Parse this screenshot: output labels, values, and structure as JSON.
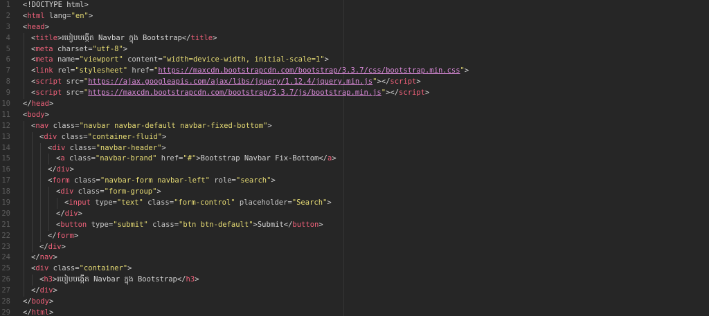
{
  "editor": {
    "lines": [
      {
        "n": "1",
        "indent": 0,
        "tokens": [
          {
            "t": "<!DOCTYPE html>",
            "c": "txt"
          }
        ]
      },
      {
        "n": "2",
        "indent": 0,
        "tokens": [
          {
            "t": "<",
            "c": "txt"
          },
          {
            "t": "html",
            "c": "tag"
          },
          {
            "t": " lang=",
            "c": "attr"
          },
          {
            "t": "\"en\"",
            "c": "str"
          },
          {
            "t": ">",
            "c": "txt"
          }
        ]
      },
      {
        "n": "3",
        "indent": 0,
        "tokens": [
          {
            "t": "<",
            "c": "txt"
          },
          {
            "t": "head",
            "c": "tag"
          },
          {
            "t": ">",
            "c": "txt"
          }
        ]
      },
      {
        "n": "4",
        "indent": 1,
        "tokens": [
          {
            "t": "<",
            "c": "txt"
          },
          {
            "t": "title",
            "c": "tag"
          },
          {
            "t": ">",
            "c": "txt"
          },
          {
            "t": "របៀបបង្កើត Navbar ក្នុង Bootstrap",
            "c": "txt"
          },
          {
            "t": "</",
            "c": "txt"
          },
          {
            "t": "title",
            "c": "tag"
          },
          {
            "t": ">",
            "c": "txt"
          }
        ]
      },
      {
        "n": "5",
        "indent": 1,
        "tokens": [
          {
            "t": "<",
            "c": "txt"
          },
          {
            "t": "meta",
            "c": "tag"
          },
          {
            "t": " charset=",
            "c": "attr"
          },
          {
            "t": "\"utf-8\"",
            "c": "str"
          },
          {
            "t": ">",
            "c": "txt"
          }
        ]
      },
      {
        "n": "6",
        "indent": 1,
        "tokens": [
          {
            "t": "<",
            "c": "txt"
          },
          {
            "t": "meta",
            "c": "tag"
          },
          {
            "t": " name=",
            "c": "attr"
          },
          {
            "t": "\"viewport\"",
            "c": "str"
          },
          {
            "t": " content=",
            "c": "attr"
          },
          {
            "t": "\"width=device-width, initial-scale=1\"",
            "c": "str"
          },
          {
            "t": ">",
            "c": "txt"
          }
        ]
      },
      {
        "n": "7",
        "indent": 1,
        "tokens": [
          {
            "t": "<",
            "c": "txt"
          },
          {
            "t": "link",
            "c": "tag"
          },
          {
            "t": " rel=",
            "c": "attr"
          },
          {
            "t": "\"stylesheet\"",
            "c": "str"
          },
          {
            "t": " href=",
            "c": "attr"
          },
          {
            "t": "\"",
            "c": "str"
          },
          {
            "t": "https://maxcdn.bootstrapcdn.com/bootstrap/3.3.7/css/bootstrap.min.css",
            "c": "url"
          },
          {
            "t": "\"",
            "c": "str"
          },
          {
            "t": ">",
            "c": "txt"
          }
        ]
      },
      {
        "n": "8",
        "indent": 1,
        "tokens": [
          {
            "t": "<",
            "c": "txt"
          },
          {
            "t": "script",
            "c": "tag"
          },
          {
            "t": " src=",
            "c": "attr"
          },
          {
            "t": "\"",
            "c": "str"
          },
          {
            "t": "https://ajax.googleapis.com/ajax/libs/jquery/1.12.4/jquery.min.js",
            "c": "url"
          },
          {
            "t": "\"",
            "c": "str"
          },
          {
            "t": "></",
            "c": "txt"
          },
          {
            "t": "script",
            "c": "tag"
          },
          {
            "t": ">",
            "c": "txt"
          }
        ]
      },
      {
        "n": "9",
        "indent": 1,
        "tokens": [
          {
            "t": "<",
            "c": "txt"
          },
          {
            "t": "script",
            "c": "tag"
          },
          {
            "t": " src=",
            "c": "attr"
          },
          {
            "t": "\"",
            "c": "str"
          },
          {
            "t": "https://maxcdn.bootstrapcdn.com/bootstrap/3.3.7/js/bootstrap.min.js",
            "c": "url"
          },
          {
            "t": "\"",
            "c": "str"
          },
          {
            "t": "></",
            "c": "txt"
          },
          {
            "t": "script",
            "c": "tag"
          },
          {
            "t": ">",
            "c": "txt"
          }
        ]
      },
      {
        "n": "10",
        "indent": 0,
        "tokens": [
          {
            "t": "</",
            "c": "txt"
          },
          {
            "t": "head",
            "c": "tag"
          },
          {
            "t": ">",
            "c": "txt"
          }
        ]
      },
      {
        "n": "11",
        "indent": 0,
        "tokens": [
          {
            "t": "<",
            "c": "txt"
          },
          {
            "t": "body",
            "c": "tag"
          },
          {
            "t": ">",
            "c": "txt"
          }
        ]
      },
      {
        "n": "12",
        "indent": 1,
        "tokens": [
          {
            "t": "<",
            "c": "txt"
          },
          {
            "t": "nav",
            "c": "tag"
          },
          {
            "t": " class=",
            "c": "attr"
          },
          {
            "t": "\"navbar navbar-default navbar-fixed-bottom\"",
            "c": "str"
          },
          {
            "t": ">",
            "c": "txt"
          }
        ]
      },
      {
        "n": "13",
        "indent": 2,
        "tokens": [
          {
            "t": "<",
            "c": "txt"
          },
          {
            "t": "div",
            "c": "tag"
          },
          {
            "t": " class=",
            "c": "attr"
          },
          {
            "t": "\"container-fluid\"",
            "c": "str"
          },
          {
            "t": ">",
            "c": "txt"
          }
        ]
      },
      {
        "n": "14",
        "indent": 3,
        "tokens": [
          {
            "t": "<",
            "c": "txt"
          },
          {
            "t": "div",
            "c": "tag"
          },
          {
            "t": " class=",
            "c": "attr"
          },
          {
            "t": "\"navbar-header\"",
            "c": "str"
          },
          {
            "t": ">",
            "c": "txt"
          }
        ]
      },
      {
        "n": "15",
        "indent": 4,
        "tokens": [
          {
            "t": "<",
            "c": "txt"
          },
          {
            "t": "a",
            "c": "tag"
          },
          {
            "t": " class=",
            "c": "attr"
          },
          {
            "t": "\"navbar-brand\"",
            "c": "str"
          },
          {
            "t": " href=",
            "c": "attr"
          },
          {
            "t": "\"#\"",
            "c": "str"
          },
          {
            "t": ">Bootstrap Navbar Fix-Bottom</",
            "c": "txt"
          },
          {
            "t": "a",
            "c": "tag"
          },
          {
            "t": ">",
            "c": "txt"
          }
        ]
      },
      {
        "n": "16",
        "indent": 3,
        "tokens": [
          {
            "t": "</",
            "c": "txt"
          },
          {
            "t": "div",
            "c": "tag"
          },
          {
            "t": ">",
            "c": "txt"
          }
        ]
      },
      {
        "n": "17",
        "indent": 3,
        "tokens": [
          {
            "t": "<",
            "c": "txt"
          },
          {
            "t": "form",
            "c": "tag"
          },
          {
            "t": " class=",
            "c": "attr"
          },
          {
            "t": "\"navbar-form navbar-left\"",
            "c": "str"
          },
          {
            "t": " role=",
            "c": "attr"
          },
          {
            "t": "\"search\"",
            "c": "str"
          },
          {
            "t": ">",
            "c": "txt"
          }
        ]
      },
      {
        "n": "18",
        "indent": 4,
        "tokens": [
          {
            "t": "<",
            "c": "txt"
          },
          {
            "t": "div",
            "c": "tag"
          },
          {
            "t": " class=",
            "c": "attr"
          },
          {
            "t": "\"form-group\"",
            "c": "str"
          },
          {
            "t": ">",
            "c": "txt"
          }
        ]
      },
      {
        "n": "19",
        "indent": 5,
        "tokens": [
          {
            "t": "<",
            "c": "txt"
          },
          {
            "t": "input",
            "c": "tag"
          },
          {
            "t": " type=",
            "c": "attr"
          },
          {
            "t": "\"text\"",
            "c": "str"
          },
          {
            "t": " class=",
            "c": "attr"
          },
          {
            "t": "\"form-control\"",
            "c": "str"
          },
          {
            "t": " placeholder=",
            "c": "attr"
          },
          {
            "t": "\"Search\"",
            "c": "str"
          },
          {
            "t": ">",
            "c": "txt"
          }
        ]
      },
      {
        "n": "20",
        "indent": 4,
        "tokens": [
          {
            "t": "</",
            "c": "txt"
          },
          {
            "t": "div",
            "c": "tag"
          },
          {
            "t": ">",
            "c": "txt"
          }
        ]
      },
      {
        "n": "21",
        "indent": 4,
        "tokens": [
          {
            "t": "<",
            "c": "txt"
          },
          {
            "t": "button",
            "c": "tag"
          },
          {
            "t": " type=",
            "c": "attr"
          },
          {
            "t": "\"submit\"",
            "c": "str"
          },
          {
            "t": " class=",
            "c": "attr"
          },
          {
            "t": "\"btn btn-default\"",
            "c": "str"
          },
          {
            "t": ">Submit</",
            "c": "txt"
          },
          {
            "t": "button",
            "c": "tag"
          },
          {
            "t": ">",
            "c": "txt"
          }
        ]
      },
      {
        "n": "22",
        "indent": 3,
        "tokens": [
          {
            "t": "</",
            "c": "txt"
          },
          {
            "t": "form",
            "c": "tag"
          },
          {
            "t": ">",
            "c": "txt"
          }
        ]
      },
      {
        "n": "23",
        "indent": 2,
        "tokens": [
          {
            "t": "</",
            "c": "txt"
          },
          {
            "t": "div",
            "c": "tag"
          },
          {
            "t": ">",
            "c": "txt"
          }
        ]
      },
      {
        "n": "24",
        "indent": 1,
        "tokens": [
          {
            "t": "</",
            "c": "txt"
          },
          {
            "t": "nav",
            "c": "tag"
          },
          {
            "t": ">",
            "c": "txt"
          }
        ]
      },
      {
        "n": "25",
        "indent": 1,
        "tokens": [
          {
            "t": "<",
            "c": "txt"
          },
          {
            "t": "div",
            "c": "tag"
          },
          {
            "t": " class=",
            "c": "attr"
          },
          {
            "t": "\"container\"",
            "c": "str"
          },
          {
            "t": ">",
            "c": "txt"
          }
        ]
      },
      {
        "n": "26",
        "indent": 2,
        "tokens": [
          {
            "t": "<",
            "c": "txt"
          },
          {
            "t": "h3",
            "c": "tag"
          },
          {
            "t": ">",
            "c": "txt"
          },
          {
            "t": "របៀបបង្កើត Navbar ក្នុង Bootstrap",
            "c": "txt"
          },
          {
            "t": "</",
            "c": "txt"
          },
          {
            "t": "h3",
            "c": "tag"
          },
          {
            "t": ">",
            "c": "txt"
          }
        ]
      },
      {
        "n": "27",
        "indent": 1,
        "tokens": [
          {
            "t": "</",
            "c": "txt"
          },
          {
            "t": "div",
            "c": "tag"
          },
          {
            "t": ">",
            "c": "txt"
          }
        ]
      },
      {
        "n": "28",
        "indent": 0,
        "tokens": [
          {
            "t": "</",
            "c": "txt"
          },
          {
            "t": "body",
            "c": "tag"
          },
          {
            "t": ">",
            "c": "txt"
          }
        ]
      },
      {
        "n": "29",
        "indent": 0,
        "tokens": [
          {
            "t": "</",
            "c": "txt"
          },
          {
            "t": "html",
            "c": "tag"
          },
          {
            "t": ">",
            "c": "txt"
          }
        ]
      }
    ]
  },
  "colors": {
    "background": "#262626",
    "tag": "#f0617a",
    "string": "#e6db74",
    "url": "#d98ad8",
    "line_number": "#5c5c5c"
  }
}
